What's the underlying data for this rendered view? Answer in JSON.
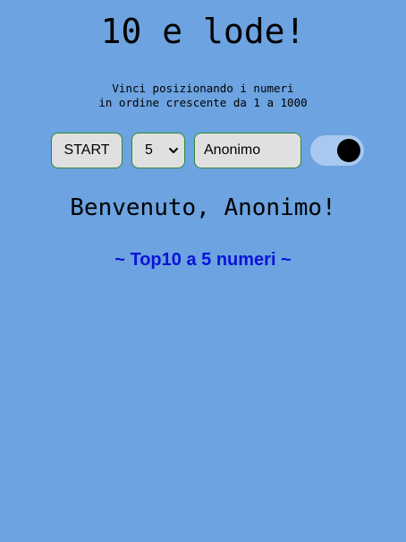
{
  "header": {
    "title": "10 e lode!",
    "subtitle_line1": "Vinci posizionando i numeri",
    "subtitle_line2": "in ordine crescente da 1 a 1000"
  },
  "controls": {
    "start_label": "START",
    "count_select": {
      "selected": "5",
      "icon": "chevron-down-icon"
    },
    "name_input": {
      "value": "Anonimo"
    },
    "toggle": {
      "state": "on",
      "track_color": "#a9c8ef",
      "knob_color": "#000000"
    }
  },
  "main": {
    "welcome": "Benvenuto, Anonimo!",
    "top10_heading": "~ Top10 a 5 numeri ~"
  },
  "colors": {
    "background": "#6ca3e0",
    "control_border": "#2e8b3a",
    "control_fill": "#e0e0e0",
    "heading_accent": "#0a14d8"
  }
}
